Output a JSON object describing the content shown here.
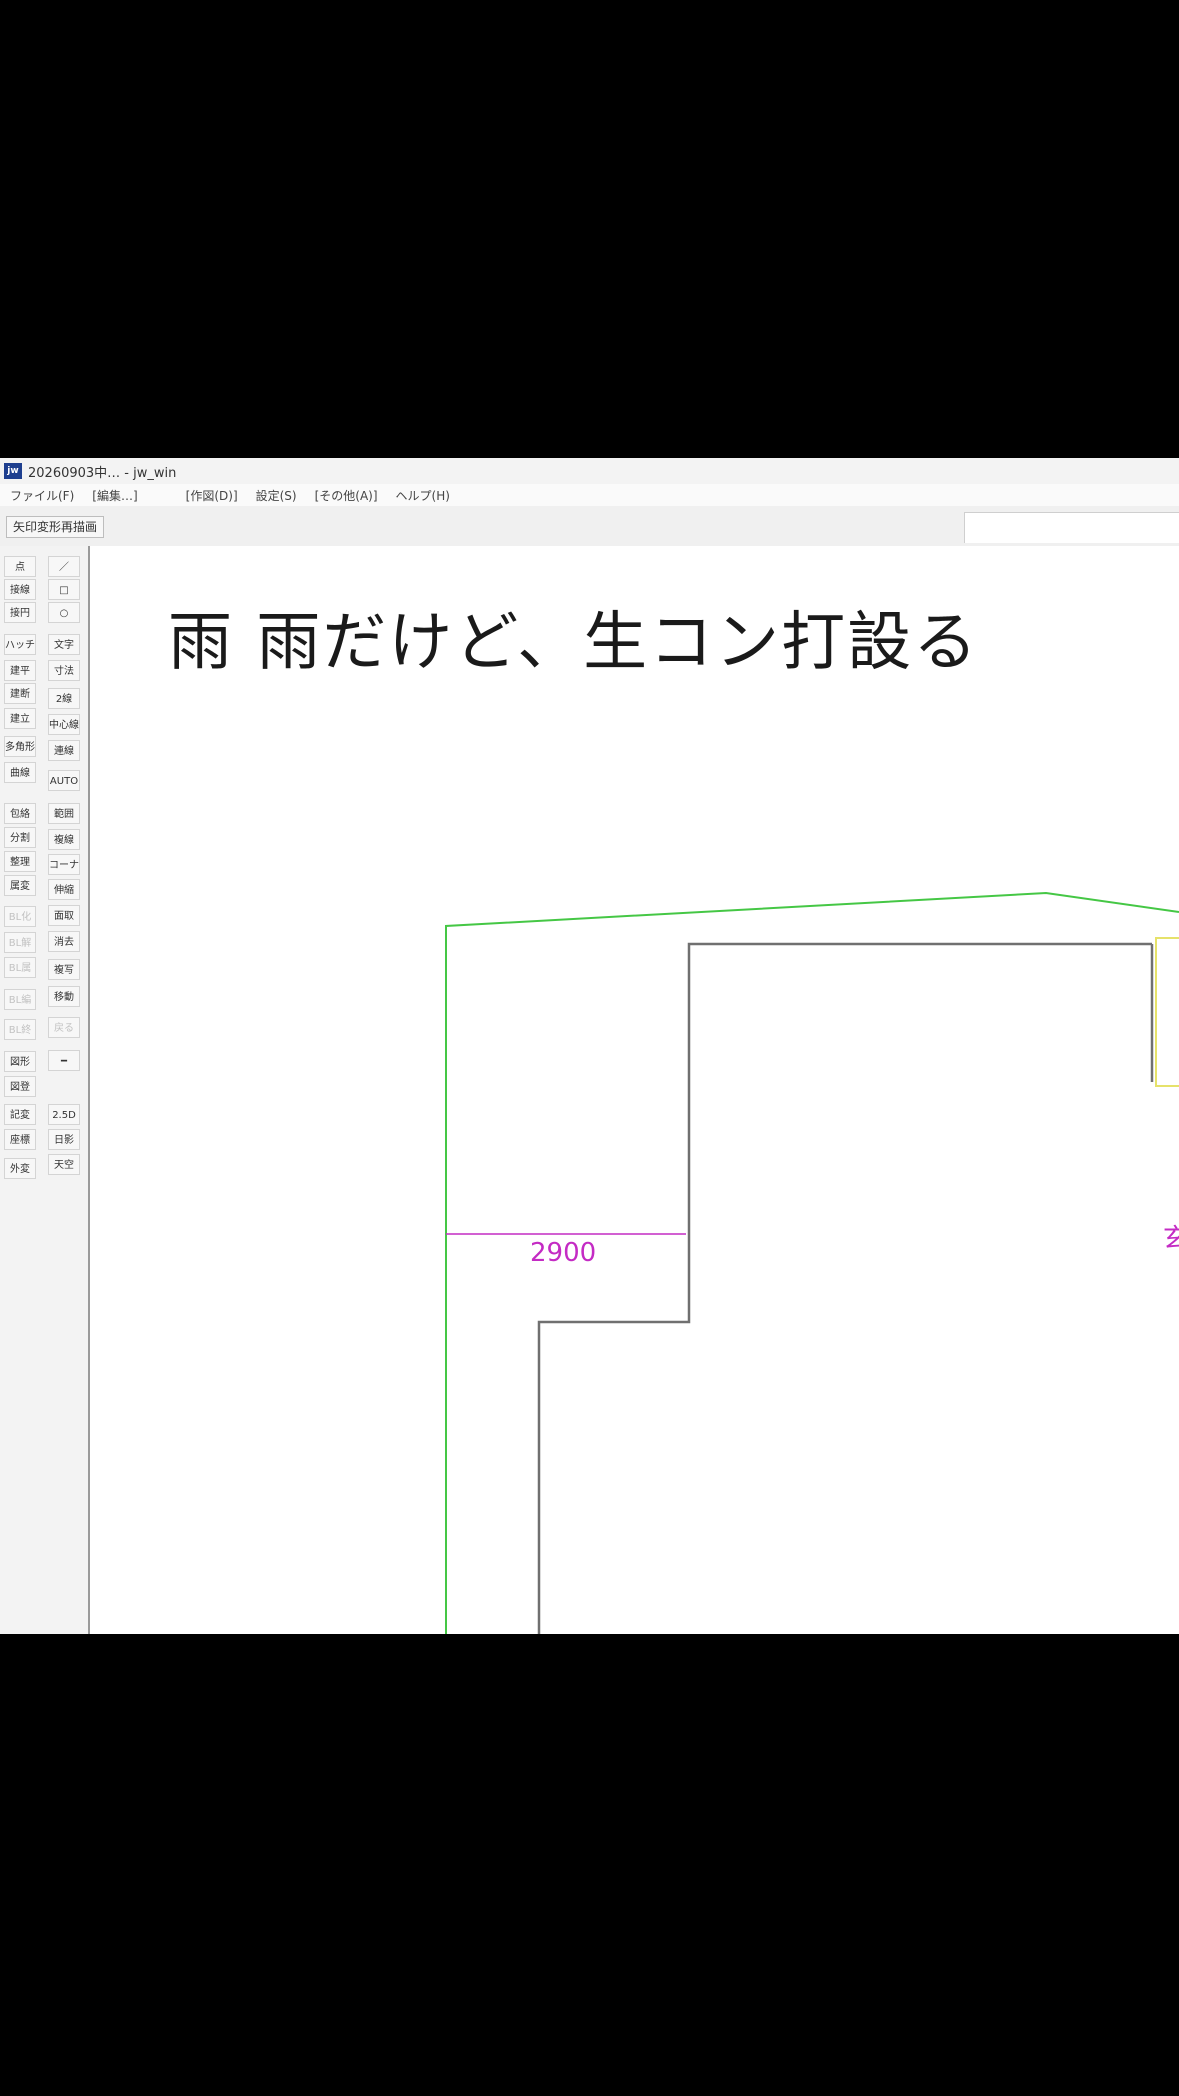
{
  "window": {
    "app_icon_label": "jw",
    "title": "20260903中… - jw_win"
  },
  "menu": [
    "ファイル(F)",
    "[編集…]",
    "[作図(D)]",
    "設定(S)",
    "[その他(A)]",
    "ヘルプ(H)"
  ],
  "toolbar": {
    "button_label": "矢印変形再描画"
  },
  "tools_left": [
    "点",
    "接線",
    "接円",
    "ハッチ",
    "建平",
    "建断",
    "建立",
    "多角形",
    "曲線",
    "包絡",
    "分割",
    "整理",
    "属変",
    "BL化",
    "BL解",
    "BL属",
    "BL編",
    "BL終",
    "図形",
    "図登",
    "記変",
    "座標",
    "外変"
  ],
  "tools_right": [
    "／",
    "□",
    "○",
    "文字",
    "寸法",
    "2線",
    "中心線",
    "連線",
    "AUTO",
    "範囲",
    "複線",
    "コーナー",
    "伸縮",
    "面取",
    "消去",
    "複写",
    "移動",
    "戻る",
    "━",
    "2.5D",
    "日影",
    "天空"
  ],
  "caption": "雨 雨だけど、生コン打設る",
  "drawing": {
    "dimension_label": "2900",
    "edge_char": "玄"
  },
  "colors": {
    "green_line": "#45c745",
    "wall_line": "#707070",
    "dimension": "#c42bc4",
    "yellow": "#e6e26a"
  }
}
